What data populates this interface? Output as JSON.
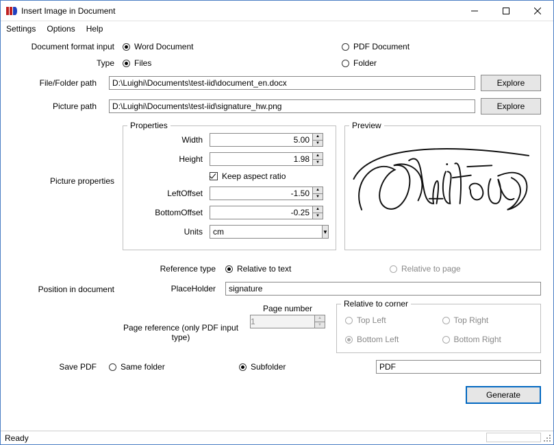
{
  "window": {
    "title": "Insert Image in Document"
  },
  "menu": {
    "settings": "Settings",
    "options": "Options",
    "help": "Help"
  },
  "labels": {
    "doc_format": "Document format input",
    "type": "Type",
    "file_path": "File/Folder path",
    "picture_path": "Picture path",
    "picture_properties": "Picture properties",
    "position_in_doc": "Position in document",
    "save_pdf": "Save PDF",
    "width": "Width",
    "height": "Height",
    "keep_aspect": "Keep aspect ratio",
    "left_offset": "LeftOffset",
    "bottom_offset": "BottomOffset",
    "units": "Units",
    "reference_type": "Reference type",
    "placeholder": "PlaceHolder",
    "page_number": "Page number",
    "page_ref_hint": "Page reference (only PDF input type)",
    "relative_to_corner": "Relative to corner",
    "top_left": "Top Left",
    "top_right": "Top Right",
    "bottom_left": "Bottom Left",
    "bottom_right": "Bottom Right"
  },
  "radios": {
    "word_doc": "Word Document",
    "pdf_doc": "PDF Document",
    "files": "Files",
    "folder": "Folder",
    "relative_text": "Relative to text",
    "relative_page": "Relative to page",
    "same_folder": "Same folder",
    "subfolder": "Subfolder"
  },
  "values": {
    "file_path": "D:\\Luighi\\Documents\\test-iid\\document_en.docx",
    "picture_path": "D:\\Luighi\\Documents\\test-iid\\signature_hw.png",
    "width": "5.00",
    "height": "1.98",
    "left_offset": "-1.50",
    "bottom_offset": "-0.25",
    "units": "cm",
    "placeholder": "signature",
    "page_number": "1",
    "save_pdf_folder": "PDF"
  },
  "buttons": {
    "explore": "Explore",
    "generate": "Generate"
  },
  "legends": {
    "properties": "Properties",
    "preview": "Preview"
  },
  "status": {
    "ready": "Ready"
  }
}
